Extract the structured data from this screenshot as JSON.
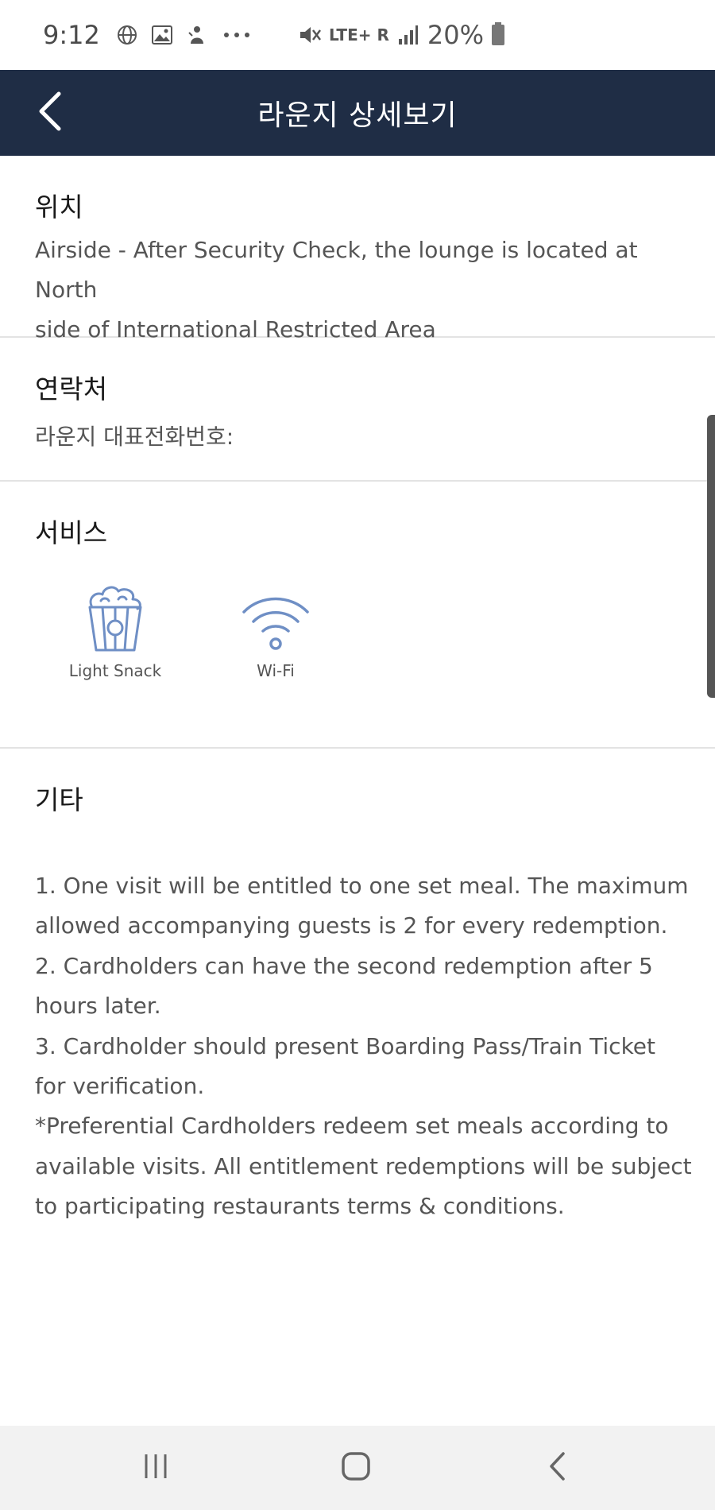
{
  "status_bar": {
    "time": "9:12",
    "network": "LTE+ R",
    "battery_percent": "20%",
    "icons": [
      "globe-icon",
      "gallery-icon",
      "app-notification-icon",
      "more-dots-icon",
      "mute-icon",
      "signal-icon",
      "battery-icon"
    ]
  },
  "header": {
    "title": "라운지 상세보기",
    "back_icon": "chevron-left-icon",
    "background": "#1f2d45"
  },
  "location": {
    "heading": "위치",
    "text_lines": [
      "Airside - After Security Check, the lounge is located at North",
      "side of International Restricted Area"
    ]
  },
  "contact": {
    "heading": "연락처",
    "text": "라운지 대표전화번호:"
  },
  "services": {
    "heading": "서비스",
    "items": [
      {
        "label": "Light Snack",
        "icon": "popcorn-icon"
      },
      {
        "label": "Wi-Fi",
        "icon": "wifi-icon"
      }
    ],
    "icon_color": "#6f8fc5"
  },
  "other": {
    "heading": "기타",
    "lines": [
      "1. One visit will be entitled to one set meal. The maximum",
      "allowed accompanying guests is 2 for every redemption.",
      "2. Cardholders can have the second redemption after 5",
      "hours later.",
      "3. Cardholder should present Boarding Pass/Train Ticket",
      "for verification.",
      "*Preferential Cardholders redeem set meals according to",
      "available visits. All entitlement redemptions will be subject",
      "to participating restaurants terms & conditions."
    ]
  },
  "nav_bar": {
    "buttons": [
      "recents-icon",
      "home-icon",
      "back-icon"
    ]
  }
}
